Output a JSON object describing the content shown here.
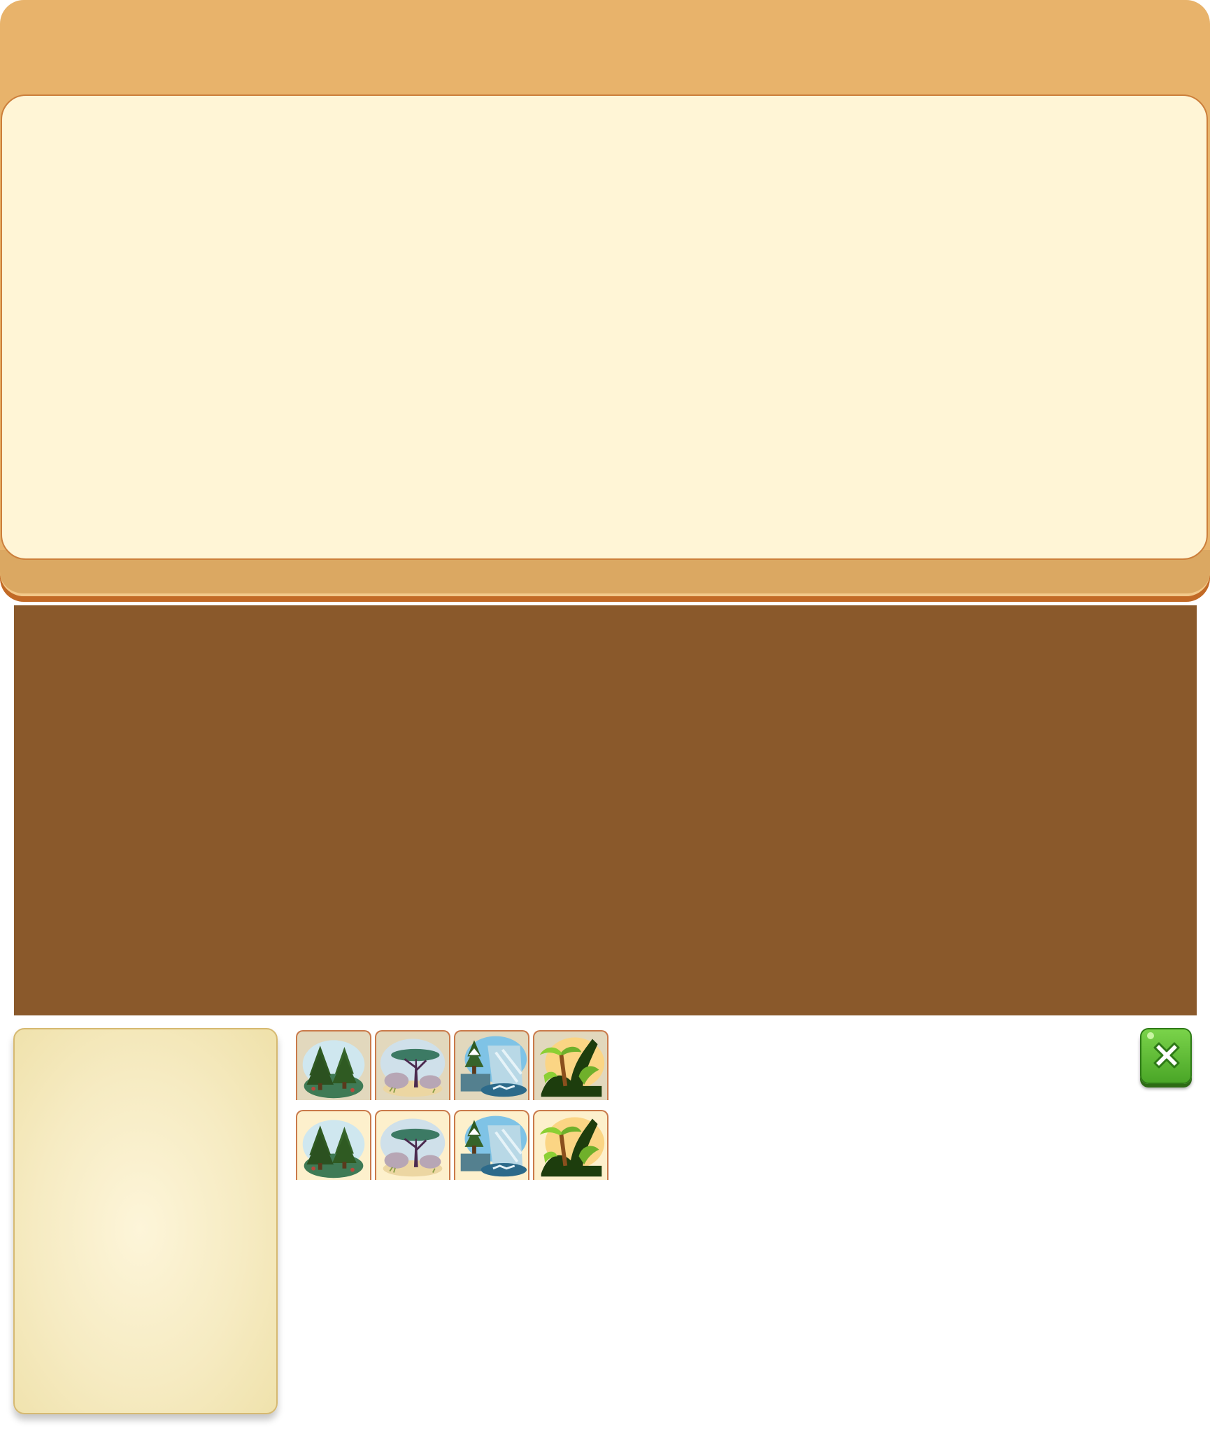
{
  "top_panel": {
    "title": ""
  },
  "banner": {
    "color": "#8a592b"
  },
  "biome_tiles": {
    "row_1": [
      {
        "icon": "pine-forest-icon",
        "state": "disabled"
      },
      {
        "icon": "savanna-icon",
        "state": "disabled"
      },
      {
        "icon": "tundra-icon",
        "state": "disabled"
      },
      {
        "icon": "jungle-icon",
        "state": "disabled"
      }
    ],
    "row_2": [
      {
        "icon": "pine-forest-icon",
        "state": "enabled"
      },
      {
        "icon": "savanna-icon",
        "state": "enabled"
      },
      {
        "icon": "tundra-icon",
        "state": "enabled"
      },
      {
        "icon": "jungle-icon",
        "state": "enabled"
      }
    ]
  },
  "close_button": {
    "icon": "close-icon",
    "color": "#5bbd34"
  }
}
